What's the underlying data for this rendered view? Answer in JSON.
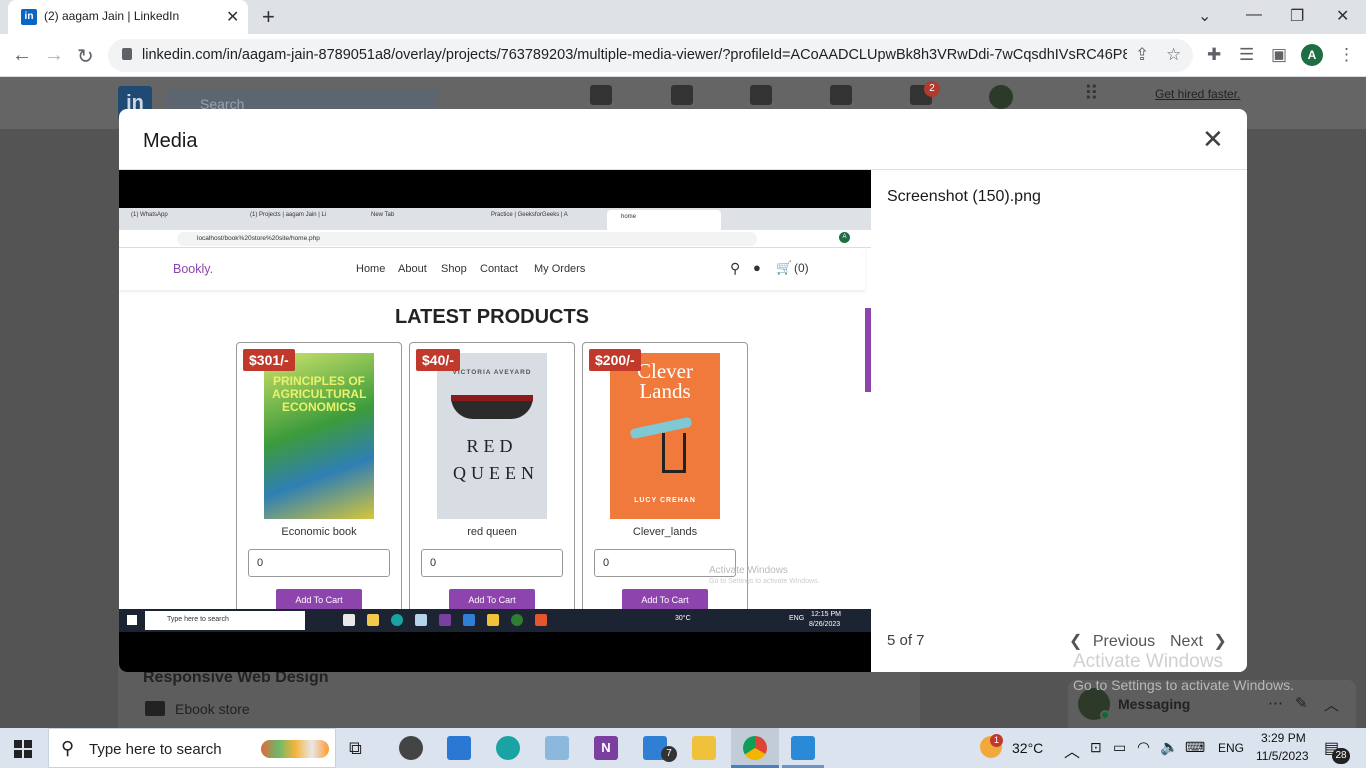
{
  "browser": {
    "tab_title": "(2) aagam Jain | LinkedIn",
    "tab_favicon": "in",
    "url": "linkedin.com/in/aagam-jain-8789051a8/overlay/projects/763789203/multiple-media-viewer/?profileId=ACoAADCLUpwBk8h3VRwDdi-7wCqsdhIVsRC46P8&tr...",
    "profile_initial": "A"
  },
  "linkedin": {
    "search_placeholder": "Search",
    "get_hired": "Get hired faster.",
    "notification_count": "2",
    "section_title": "Responsive Web Design",
    "folder_label": "Ebook store",
    "messaging_label": "Messaging"
  },
  "modal": {
    "title": "Media",
    "file_name": "Screenshot (150).png",
    "counter": "5 of 7",
    "prev_label": "Previous",
    "next_label": "Next"
  },
  "screenshot": {
    "tabs": [
      "(1) WhatsApp",
      "(1) Projects | aagam Jain | Li",
      "New Tab",
      "Practice | GeeksforGeeks | A",
      "home"
    ],
    "url": "localhost/book%20store%20site/home.php",
    "brand": "Bookly.",
    "menu": [
      "Home",
      "About",
      "Shop",
      "Contact",
      "My Orders"
    ],
    "cart": "(0)",
    "heading": "LATEST PRODUCTS",
    "products": [
      {
        "name": "Economic book",
        "price": "$301/-",
        "qty": "0",
        "cover_text": "PRINCIPLES OF AGRICULTURAL ECONOMICS"
      },
      {
        "name": "red queen",
        "price": "$40/-",
        "qty": "0",
        "cover_text": "RED QUEEN",
        "cover_author": "VICTORIA AVEYARD"
      },
      {
        "name": "Clever_lands",
        "price": "$200/-",
        "qty": "0",
        "cover_text": "Clever Lands",
        "cover_author": "LUCY CREHAN"
      }
    ],
    "add_to_cart": "Add To Cart",
    "watermark_line1": "Activate Windows",
    "watermark_line2": "Go to Settings to activate Windows.",
    "taskbar_search": "Type here to search",
    "temperature": "30°C",
    "lang": "ENG",
    "time": "12:15 PM",
    "date": "8/26/2023"
  },
  "taskbar": {
    "search_placeholder": "Type here to search",
    "temperature": "32°C",
    "weather_badge": "1",
    "mail_badge": "7",
    "lang": "ENG",
    "time": "3:29 PM",
    "date": "11/5/2023",
    "notification_count": "28"
  },
  "watermark": {
    "line1": "Activate Windows",
    "line2": "Go to Settings to activate Windows."
  }
}
